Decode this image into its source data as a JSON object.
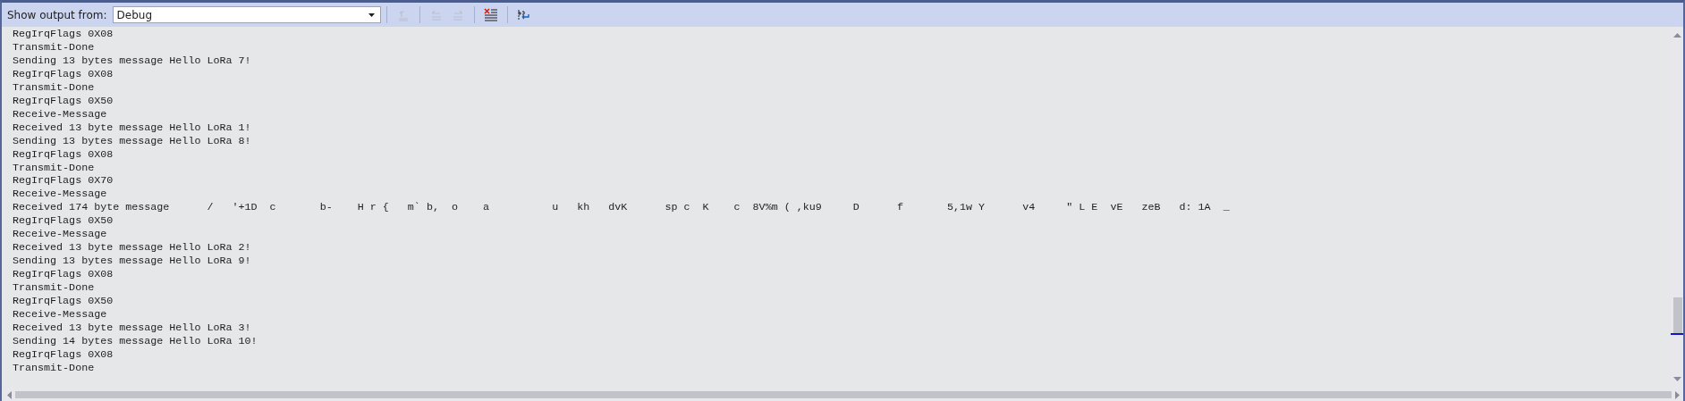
{
  "toolbar": {
    "label": "Show output from:",
    "source": {
      "value": "Debug"
    },
    "buttons": [
      {
        "kind": "find",
        "disabled": true
      },
      {
        "kind": "prev",
        "disabled": true
      },
      {
        "kind": "next",
        "disabled": true
      },
      {
        "kind": "clear",
        "disabled": false
      },
      {
        "kind": "wrap",
        "disabled": false
      }
    ]
  },
  "lines": [
    "RegIrqFlags 0X08",
    "Transmit-Done",
    "Sending 13 bytes message Hello LoRa 7!",
    "RegIrqFlags 0X08",
    "Transmit-Done",
    "RegIrqFlags 0X50",
    "Receive-Message",
    "Received 13 byte message Hello LoRa 1!",
    "Sending 13 bytes message Hello LoRa 8!",
    "RegIrqFlags 0X08",
    "Transmit-Done",
    "RegIrqFlags 0X70",
    "Receive-Message",
    "Received 174 byte message      /   '+1D  c       b-    H r {   m` b,  o    a          u   kh   dvK      sp c  K    c  8V%m ( ,ku9     D      f       5,1w Y      v4     \" L E  vE   zeB   d: 1A  _",
    "RegIrqFlags 0X50",
    "Receive-Message",
    "Received 13 byte message Hello LoRa 2!",
    "Sending 13 bytes message Hello LoRa 9!",
    "RegIrqFlags 0X08",
    "Transmit-Done",
    "RegIrqFlags 0X50",
    "Receive-Message",
    "Received 13 byte message Hello LoRa 3!",
    "Sending 14 bytes message Hello LoRa 10!",
    "RegIrqFlags 0X08",
    "Transmit-Done"
  ]
}
